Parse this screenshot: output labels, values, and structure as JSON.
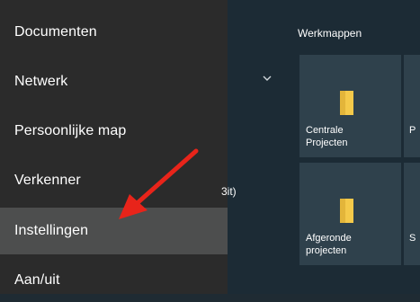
{
  "start_menu": {
    "items": [
      {
        "label": "Documenten"
      },
      {
        "label": "Netwerk"
      },
      {
        "label": "Persoonlijke map"
      },
      {
        "label": "Verkenner"
      },
      {
        "label": "Instellingen"
      },
      {
        "label": "Aan/uit"
      }
    ],
    "hovered_item": "Instellingen"
  },
  "tiles_panel": {
    "group_title": "Werkmappen",
    "clipped_text": "3it)",
    "tiles": [
      {
        "label": "Centrale\nProjecten",
        "icon": "folder-icon"
      },
      {
        "label": "P",
        "icon": "folder-icon"
      },
      {
        "label": "Afgeronde\nprojecten",
        "icon": "folder-icon"
      },
      {
        "label": "S",
        "icon": "folder-icon"
      }
    ]
  },
  "colors": {
    "menu_bg": "#2b2b2b",
    "menu_hover": "#4d4e4e",
    "tile_bg": "#2f414c",
    "folder": "#f4c94a",
    "annotation_arrow": "#e8241a"
  }
}
